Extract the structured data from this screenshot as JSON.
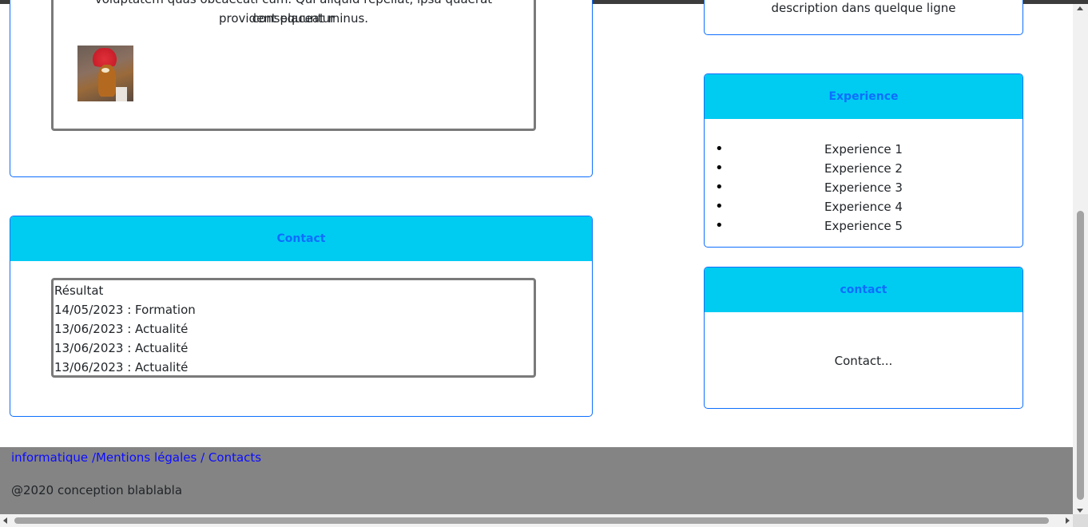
{
  "left_top_card": {
    "text_line_1": "voluptatem quas obcaecati cum. Qui aliquid repellat, ipsa quaerat consequuntur",
    "text_line_2": "provident placeat minus."
  },
  "contact_card": {
    "title": "Contact",
    "results": [
      "Résultat",
      "14/05/2023 : Formation",
      "13/06/2023 : Actualité",
      "13/06/2023 : Actualité",
      "13/06/2023 : Actualité"
    ]
  },
  "right_top_card": {
    "text": "description dans quelque ligne"
  },
  "experience_card": {
    "title": "Experience",
    "items": [
      "Experience 1",
      "Experience 2",
      "Experience 3",
      "Experience 4",
      "Experience 5"
    ]
  },
  "contact_side_card": {
    "title": "contact",
    "text": "Contact..."
  },
  "footer": {
    "link_1": "informatique",
    "link_2": "/Mentions légales",
    "link_3": "/ Contacts",
    "copyright": "@2020 conception blablabla"
  },
  "colors": {
    "card_header_bg": "#00ccf2",
    "card_header_text": "#0d6efd",
    "footer_bg": "#848484"
  }
}
